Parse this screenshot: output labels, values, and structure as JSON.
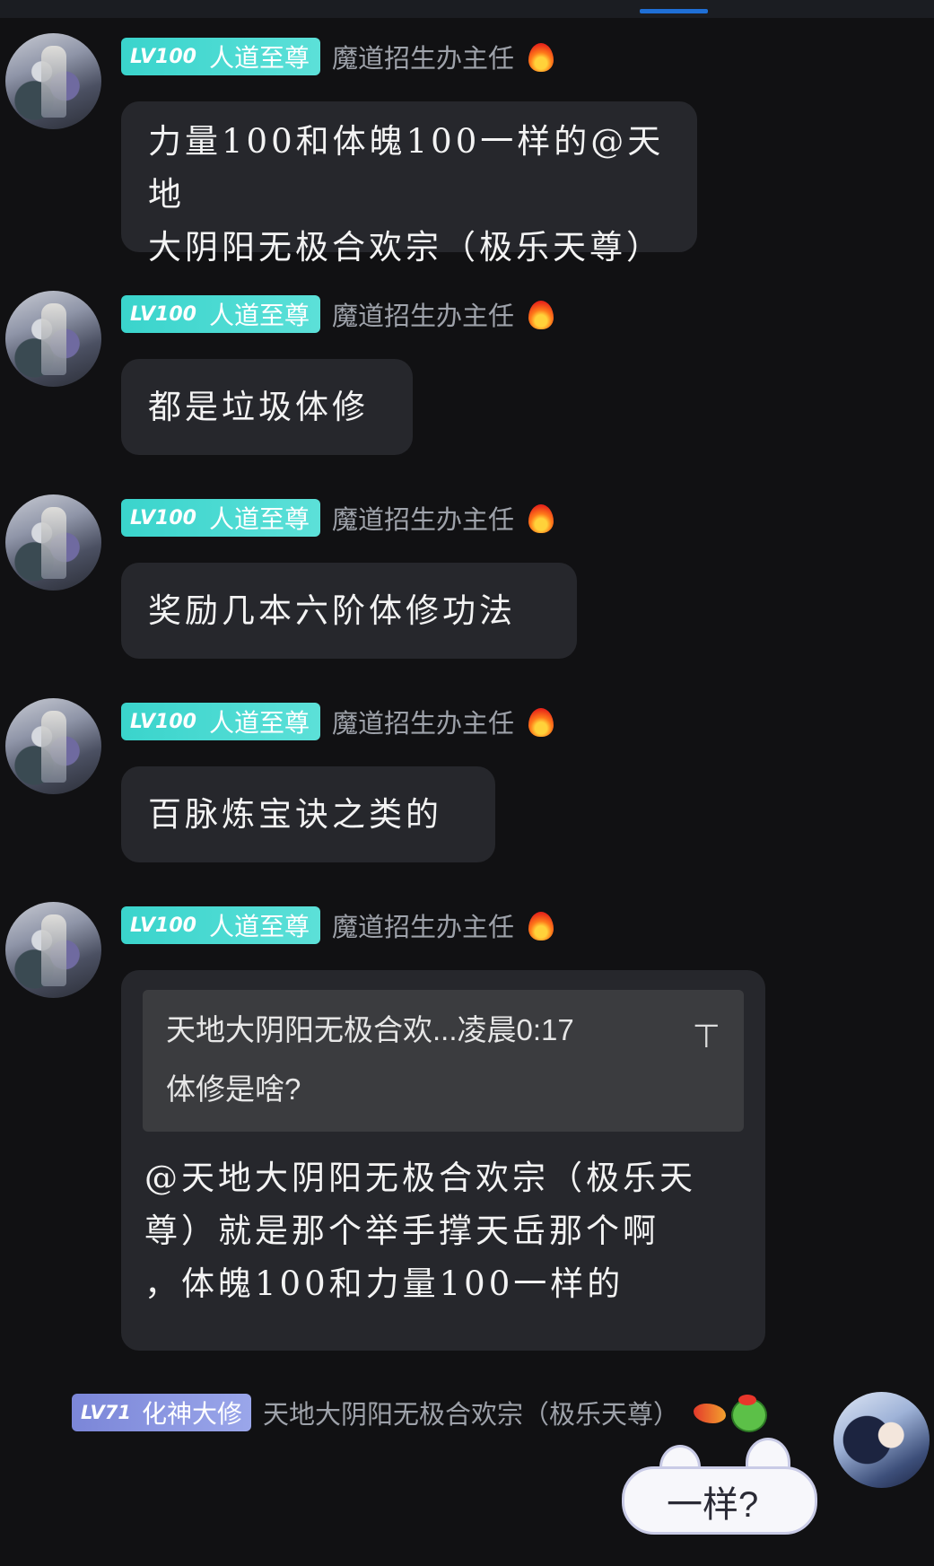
{
  "header": {},
  "sender": {
    "level": "LV100",
    "rank": "人道至尊",
    "nickname": "魔道招生办主任"
  },
  "messages": [
    {
      "lines": [
        "力量100和体魄100一样的@天地",
        "大阴阳无极合欢宗（极乐天尊）"
      ]
    },
    {
      "lines": [
        "都是垃圾体修"
      ]
    },
    {
      "lines": [
        "奖励几本六阶体修功法"
      ]
    },
    {
      "lines": [
        "百脉炼宝诀之类的"
      ]
    },
    {
      "quote": {
        "header": "天地大阴阳无极合欢...凌晨0:17",
        "text": "体修是啥?",
        "jump_icon": "up-arrow-icon"
      },
      "lines": [
        "@天地大阴阳无极合欢宗（极乐天",
        "尊）就是那个举手撑天岳那个啊",
        "，体魄100和力量100一样的"
      ]
    }
  ],
  "me": {
    "level": "LV71",
    "rank": "化神大修",
    "nickname": "天地大阴阳无极合欢宗（极乐天尊）",
    "sticker_text": "一样?"
  },
  "colors": {
    "background": "#111113",
    "bubble": "#26272c",
    "badge_teal": "#3ad4cc",
    "badge_purple": "#7b86d8",
    "quote_bg": "#3b3c3f",
    "tab_indicator": "#1f6fd6"
  }
}
